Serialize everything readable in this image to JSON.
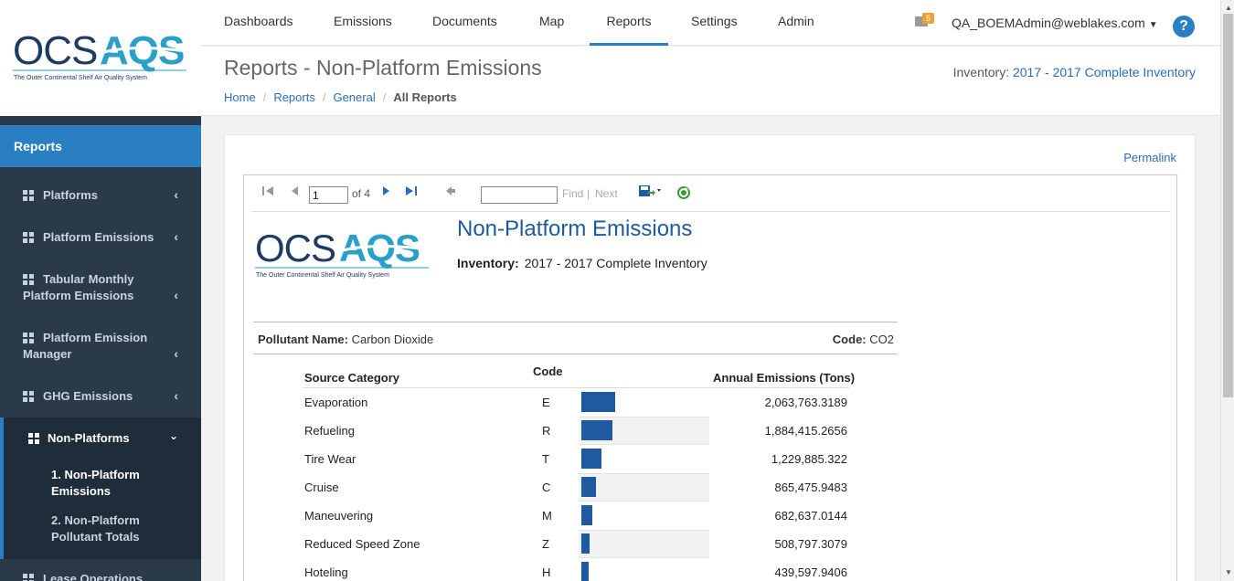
{
  "app": {
    "logo_text": "OCSAQS",
    "logo_tagline": "The Outer Continental Shelf Air Quality System"
  },
  "topnav": {
    "items": [
      "Dashboards",
      "Emissions",
      "Documents",
      "Map",
      "Reports",
      "Settings",
      "Admin"
    ],
    "active": "Reports",
    "mail_count": "5",
    "user": "QA_BOEMAdmin@weblakes.com",
    "help": "?"
  },
  "header": {
    "title": "Reports - Non-Platform Emissions",
    "inventory_label": "Inventory:",
    "inventory_value": "2017 - 2017 Complete Inventory",
    "breadcrumb": [
      "Home",
      "Reports",
      "General",
      "All Reports"
    ]
  },
  "sidebar": {
    "section": "Reports",
    "items": [
      {
        "label": "Platforms"
      },
      {
        "label": "Platform Emissions"
      },
      {
        "label": "Tabular Monthly Platform Emissions"
      },
      {
        "label": "Platform Emission Manager"
      },
      {
        "label": "GHG Emissions"
      },
      {
        "label": "Non-Platforms"
      },
      {
        "label": "Lease Operations"
      }
    ],
    "sub_items": [
      {
        "label": "1. Non-Platform Emissions"
      },
      {
        "label": "2. Non-Platform Pollutant Totals"
      }
    ]
  },
  "card": {
    "permalink": "Permalink"
  },
  "toolbar": {
    "page_value": "1",
    "page_of": "of 4",
    "find": "Find",
    "divider": "|",
    "next": "Next",
    "find_value": ""
  },
  "report": {
    "title": "Non-Platform Emissions",
    "inventory_label": "Inventory:",
    "inventory_value": "2017 - 2017 Complete Inventory",
    "pollutant_label": "Pollutant Name:",
    "pollutant_value": "Carbon Dioxide",
    "code_label": "Code:",
    "code_value": "CO2",
    "columns": {
      "category": "Source Category",
      "code": "Code",
      "emissions": "Annual Emissions (Tons)"
    },
    "rows": [
      {
        "category": "Evaporation",
        "code": "E",
        "value": "2,063,763.3189",
        "num": 2063763.3189
      },
      {
        "category": "Refueling",
        "code": "R",
        "value": "1,884,415.2656",
        "num": 1884415.2656
      },
      {
        "category": "Tire Wear",
        "code": "T",
        "value": "1,229,885.322",
        "num": 1229885.322
      },
      {
        "category": "Cruise",
        "code": "C",
        "value": "865,475.9483",
        "num": 865475.9483
      },
      {
        "category": "Maneuvering",
        "code": "M",
        "value": "682,637.0144",
        "num": 682637.0144
      },
      {
        "category": "Reduced Speed Zone",
        "code": "Z",
        "value": "508,797.3079",
        "num": 508797.3079
      },
      {
        "category": "Hoteling",
        "code": "H",
        "value": "439,597.9406",
        "num": 439597.9406
      }
    ]
  },
  "colors": {
    "accent": "#2a7fc3",
    "sidebar": "#2b3a4a",
    "bar": "#1f5aa0"
  }
}
